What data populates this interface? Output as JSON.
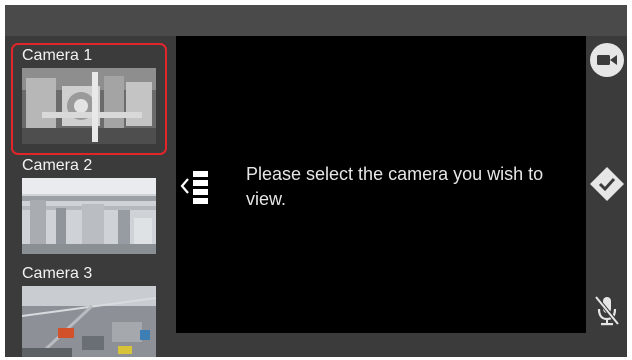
{
  "cameras": [
    {
      "label": "Camera 1",
      "selected": true
    },
    {
      "label": "Camera 2",
      "selected": false
    },
    {
      "label": "Camera 3",
      "selected": false
    }
  ],
  "main": {
    "message": "Please select the camera you wish to view."
  },
  "icons": {
    "collapse": "collapse-panel-icon",
    "video": "video-camera-icon",
    "diamond_check": "diamond-check-icon",
    "mic_muted": "microphone-muted-icon"
  },
  "colors": {
    "selection_border": "#e0262b",
    "main_background": "#000000",
    "panel_background": "#3b3b3b"
  }
}
